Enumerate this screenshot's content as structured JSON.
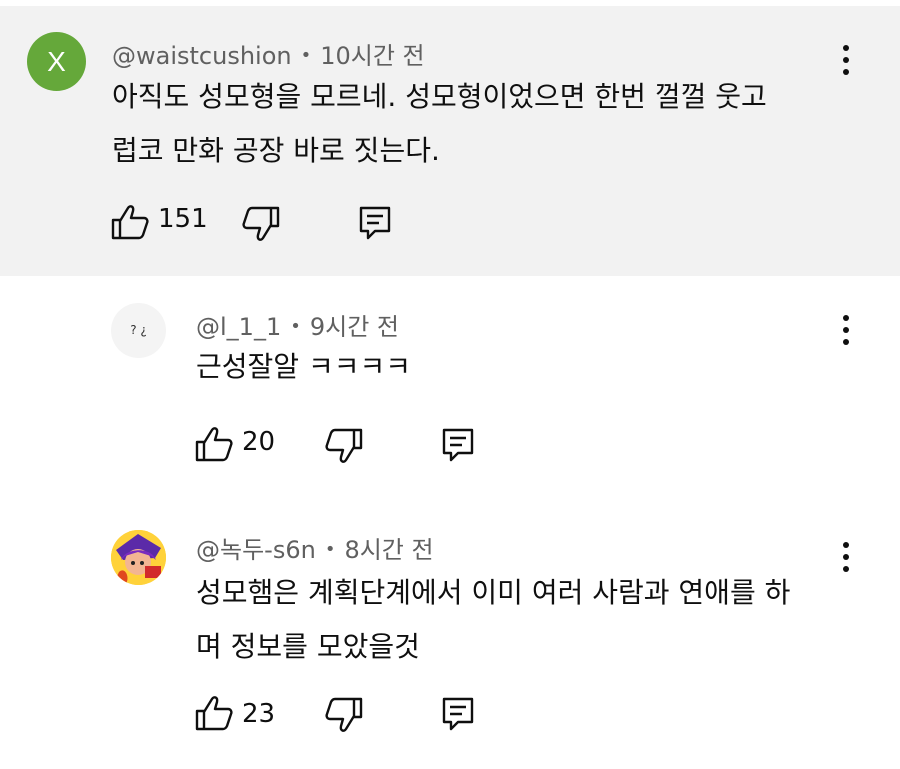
{
  "comments": [
    {
      "avatar_letter": "X",
      "author": "@waistcushion",
      "separator": "•",
      "time": "10시간 전",
      "text_lines": [
        "아직도 성모형을 모르네. 성모형이었으면 한번 껄껄 웃고",
        "럽코 만화 공장 바로 짓는다."
      ],
      "likes": "151"
    },
    {
      "avatar_text": "? ¿",
      "author": "@l_1_1",
      "separator": "•",
      "time": "9시간 전",
      "text_lines": [
        "근성잘알 ㅋㅋㅋㅋ"
      ],
      "likes": "20"
    },
    {
      "author": "@녹두-s6n",
      "separator": "•",
      "time": "8시간 전",
      "text_lines": [
        "성모햄은 계획단계에서 이미 여러 사람과 연애를 하",
        "며 정보를 모았을것"
      ],
      "likes": "23"
    }
  ],
  "icons": {
    "like": "thumbs-up-icon",
    "dislike": "thumbs-down-icon",
    "reply": "reply-icon",
    "menu": "more-vertical-icon"
  },
  "colors": {
    "highlight_bg": "#f2f2f2",
    "avatar_green": "#65a83a",
    "meta_gray": "#606060",
    "text": "#0f0f0f"
  }
}
